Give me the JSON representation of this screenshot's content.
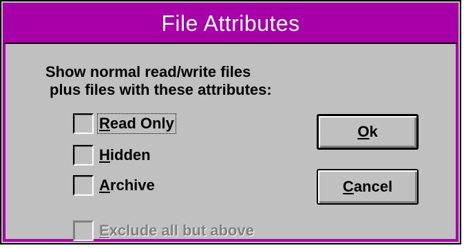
{
  "dialog": {
    "title": "File Attributes",
    "description_line1": "Show normal read/write files",
    "description_line2": "plus files with these attributes:"
  },
  "checkboxes": [
    {
      "mnemonic": "R",
      "rest": "ead Only",
      "checked": false,
      "focused": true,
      "enabled": true
    },
    {
      "mnemonic": "H",
      "rest": "idden",
      "checked": false,
      "focused": false,
      "enabled": true
    },
    {
      "mnemonic": "A",
      "rest": "rchive",
      "checked": false,
      "focused": false,
      "enabled": true
    }
  ],
  "exclude": {
    "mnemonic": "E",
    "rest": "xclude all but above",
    "checked": false,
    "enabled": false
  },
  "buttons": {
    "ok": {
      "mnemonic": "O",
      "rest": "k"
    },
    "cancel": {
      "mnemonic": "C",
      "rest": "ancel"
    }
  },
  "colors": {
    "titlebar": "#a800a8",
    "face": "#c0c0c0",
    "disabled_text": "#808080"
  }
}
